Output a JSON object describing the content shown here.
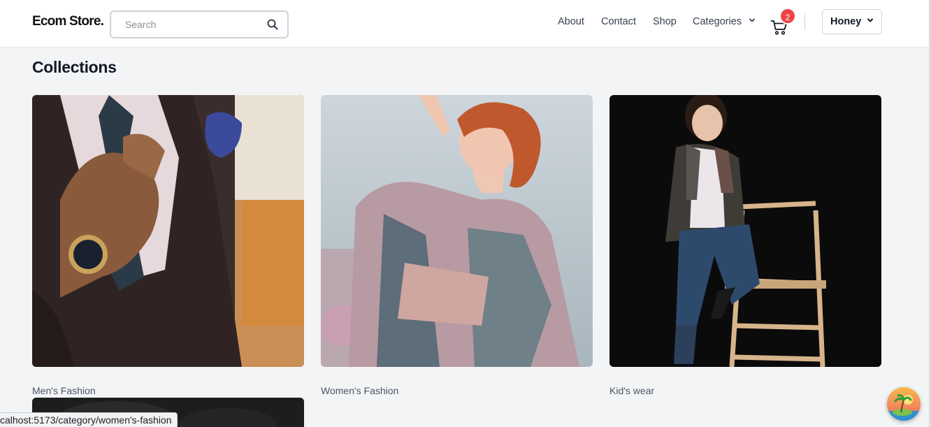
{
  "header": {
    "logo": "Ecom Store.",
    "search_placeholder": "Search",
    "nav": {
      "about": "About",
      "contact": "Contact",
      "shop": "Shop",
      "categories": "Categories"
    },
    "cart_count": "2",
    "user_name": "Honey"
  },
  "page_title": "Collections",
  "collections": [
    {
      "label": "Men's Fashion"
    },
    {
      "label": "Women's Fashion"
    },
    {
      "label": "Kid's wear"
    }
  ],
  "status_url": "calhost:5173/category/women's-fashion",
  "colors": {
    "badge": "#ef4444",
    "page_bg": "#f3f4f6"
  },
  "icons": [
    "search-icon",
    "chevron-down-icon",
    "cart-icon"
  ]
}
